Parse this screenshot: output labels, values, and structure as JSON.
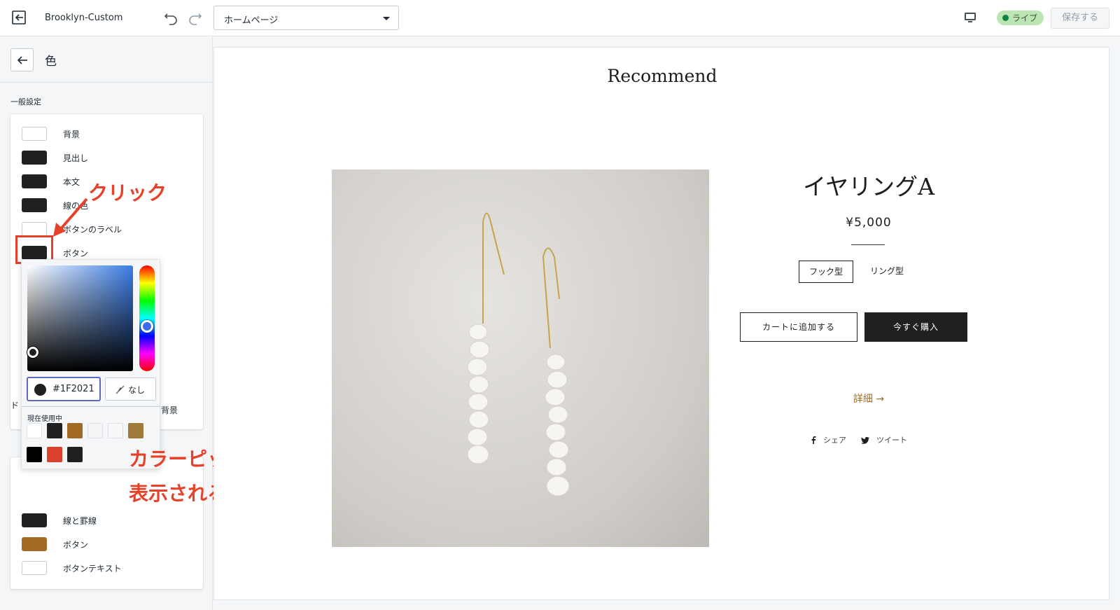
{
  "topbar": {
    "theme_name": "Brooklyn-Custom",
    "page_select_value": "ホームページ",
    "live_label": "ライブ",
    "save_label": "保存する"
  },
  "sidebar": {
    "title": "色",
    "section_general": "一般設定",
    "general_items": [
      {
        "label": "背景",
        "color": "#ffffff"
      },
      {
        "label": "見出し",
        "color": "#1f2021"
      },
      {
        "label": "本文",
        "color": "#1f2021"
      },
      {
        "label": "線の色",
        "color": "#1f2021"
      },
      {
        "label": "ボタンのラベル",
        "color": "#ffffff"
      },
      {
        "label": "ボタン",
        "color": "#1f2021"
      }
    ],
    "partial_label_bg": "背景",
    "partial_label_section": "ド",
    "second_items": [
      {
        "label": "線と罫線",
        "color": "#1f2021"
      },
      {
        "label": "ボタン",
        "color": "#a26b25"
      },
      {
        "label": "ボタンテキスト",
        "color": "#ffffff"
      }
    ]
  },
  "color_picker": {
    "hex_value": "#1F2021",
    "none_label": "なし",
    "in_use_label": "現在使用中",
    "in_use_colors": [
      "#ffffff",
      "#1f2021",
      "#a26b25",
      "#f4f4f4",
      "#f8f8f8",
      "#a07a3a",
      "#000000",
      "#d9412e",
      "#1f2021"
    ]
  },
  "annotations": {
    "click": "クリック",
    "picker_line1": "カラーピッカーが",
    "picker_line2": "表示される"
  },
  "preview": {
    "section_title": "Recommend",
    "product_name": "イヤリングA",
    "price": "¥5,000",
    "variant_selected": "フック型",
    "variant_other": "リング型",
    "add_to_cart": "カートに追加する",
    "buy_now": "今すぐ購入",
    "details_link": "詳細 →",
    "share_label": "シェア",
    "tweet_label": "ツイート"
  }
}
